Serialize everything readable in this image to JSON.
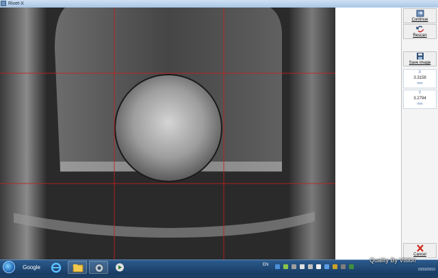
{
  "window": {
    "title": "Rivet-X"
  },
  "panel": {
    "continue_label": "Continue",
    "rescan_label": "Rescan",
    "save_label": "Save image",
    "cancel_label": "Cancel",
    "x_readout": {
      "axis": "X",
      "value": "3.3158",
      "unit": "mm"
    },
    "y_readout": {
      "axis": "Y",
      "value": "3.2794",
      "unit": "mm"
    }
  },
  "taskbar": {
    "google_label": "Google",
    "lang": "EN",
    "date": "03/03/2010"
  },
  "watermark": "Quality By Vision",
  "colors": {
    "crosshair": "#c81e1e",
    "panel_bg": "#f4f4f4",
    "taskbar": "#1f4a78"
  },
  "icons": [
    "continue-icon",
    "rescan-icon",
    "save-icon",
    "cancel-icon"
  ]
}
